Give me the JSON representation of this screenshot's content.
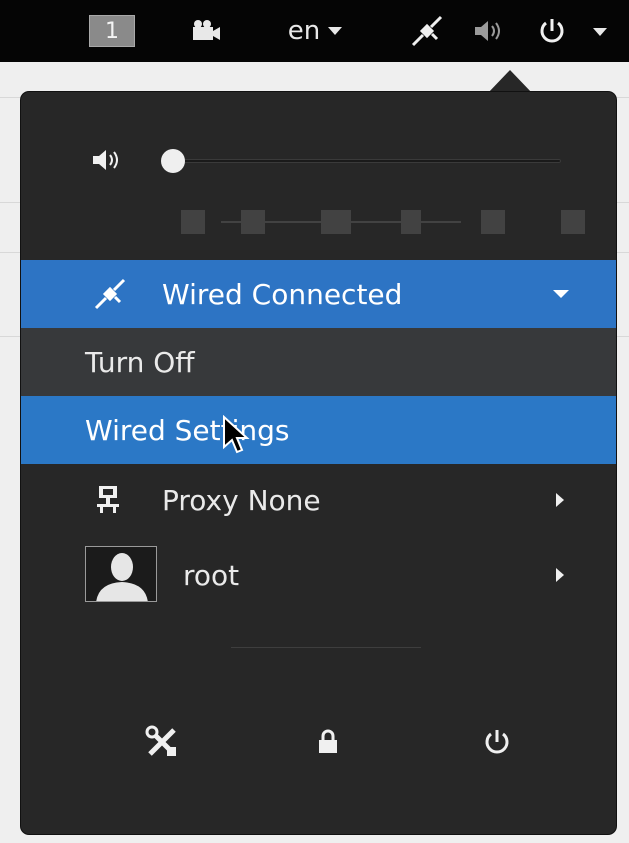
{
  "topbar": {
    "workspace_number": "1",
    "language": "en",
    "icons": [
      "camera-icon",
      "network-wired-icon",
      "volume-icon",
      "power-icon"
    ]
  },
  "volume": {
    "level": 0.0,
    "icon": "volume-icon"
  },
  "network": {
    "label": "Wired Connected",
    "icon": "network-wired-icon",
    "submenu": {
      "turn_off": "Turn Off",
      "settings": "Wired Settings"
    }
  },
  "proxy": {
    "label": "Proxy None",
    "icon": "proxy-icon"
  },
  "user": {
    "name": "root",
    "icon": "user-avatar-icon"
  },
  "actions": {
    "icons": [
      "settings-icon",
      "lock-icon",
      "power-icon"
    ]
  },
  "colors": {
    "highlight": "#2b78c6",
    "menu_bg": "#272727",
    "topbar_bg": "#050505"
  }
}
